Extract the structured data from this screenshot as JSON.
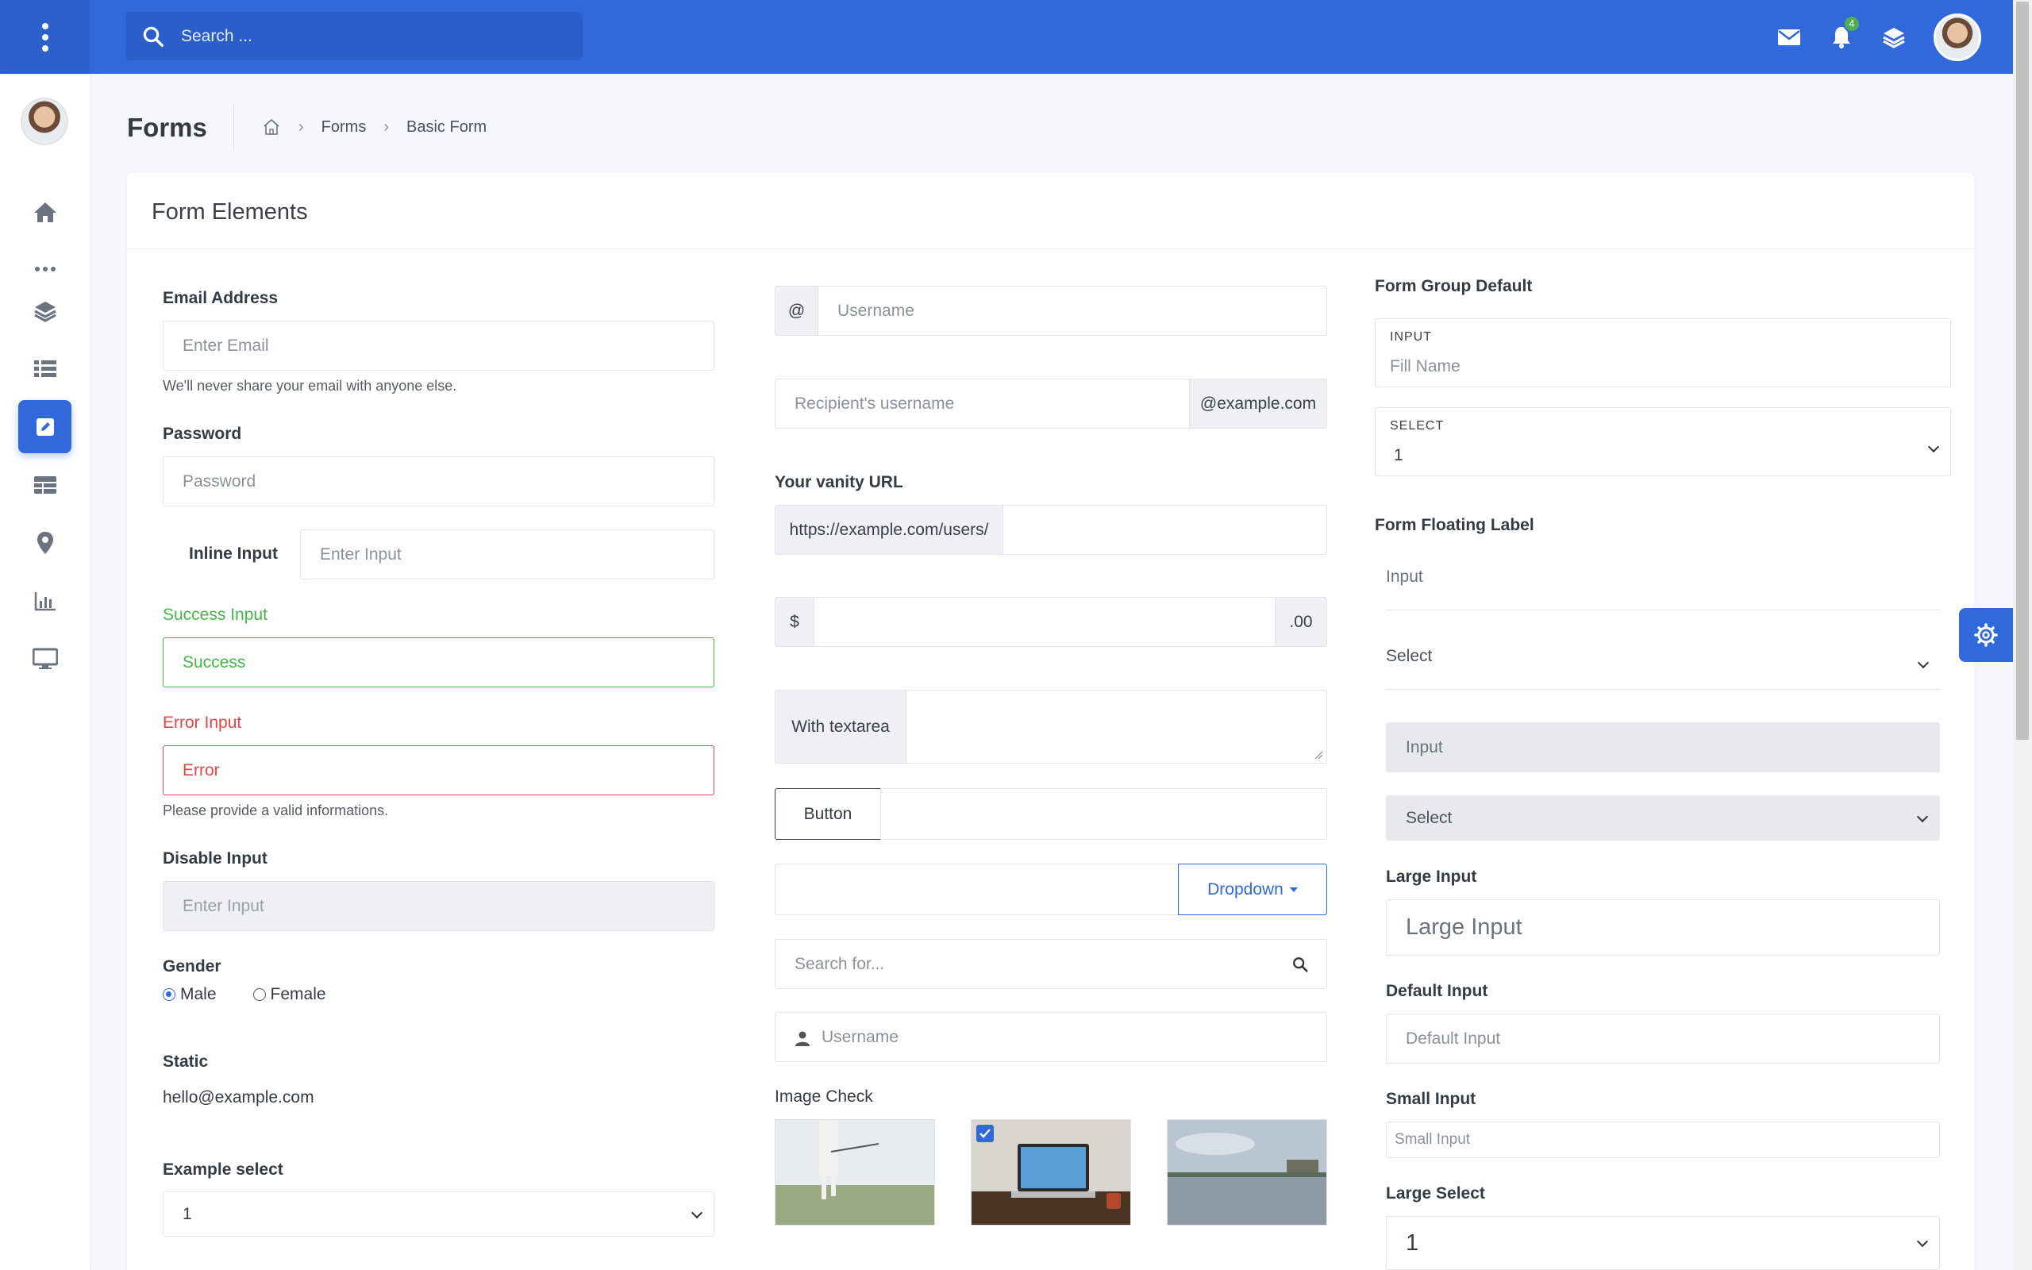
{
  "header": {
    "search_placeholder": "Search ...",
    "notification_count": "4"
  },
  "sidebar": {
    "items": [
      "home",
      "more",
      "layers",
      "list",
      "forms",
      "tables",
      "maps",
      "charts",
      "desktop"
    ]
  },
  "page": {
    "title": "Forms",
    "breadcrumb": [
      "Forms",
      "Basic Form"
    ]
  },
  "card": {
    "title": "Form Elements"
  },
  "col1": {
    "email_label": "Email Address",
    "email_placeholder": "Enter Email",
    "email_hint": "We'll never share your email with anyone else.",
    "password_label": "Password",
    "password_placeholder": "Password",
    "inline_label": "Inline Input",
    "inline_placeholder": "Enter Input",
    "success_label": "Success Input",
    "success_value": "Success",
    "error_label": "Error Input",
    "error_value": "Error",
    "error_hint": "Please provide a valid informations.",
    "disable_label": "Disable Input",
    "disable_placeholder": "Enter Input",
    "gender_label": "Gender",
    "gender_male": "Male",
    "gender_female": "Female",
    "static_label": "Static",
    "static_value": "hello@example.com",
    "select_label": "Example select",
    "select_value": "1"
  },
  "col2": {
    "at_addon": "@",
    "username_placeholder": "Username",
    "recipient_placeholder": "Recipient's username",
    "recipient_addon": "@example.com",
    "vanity_label": "Your vanity URL",
    "vanity_addon": "https://example.com/users/",
    "dollar_addon": "$",
    "cents_addon": ".00",
    "textarea_addon": "With textarea",
    "button_label": "Button",
    "dropdown_label": "Dropdown",
    "search_placeholder": "Search for...",
    "user_placeholder": "Username",
    "image_check_label": "Image Check"
  },
  "col3": {
    "group_default_label": "Form Group Default",
    "input_caption": "INPUT",
    "input_placeholder": "Fill Name",
    "select_caption": "SELECT",
    "select_value": "1",
    "floating_label": "Form Floating Label",
    "float_input": "Input",
    "float_select": "Select",
    "filled_input": "Input",
    "filled_select": "Select",
    "large_input_label": "Large Input",
    "large_input_placeholder": "Large Input",
    "default_input_label": "Default Input",
    "default_input_placeholder": "Default Input",
    "small_input_label": "Small Input",
    "small_input_placeholder": "Small Input",
    "large_select_label": "Large Select",
    "large_select_value": "1"
  },
  "colors": {
    "primary": "#3169db",
    "success": "#46b54a",
    "danger": "#e04848"
  }
}
